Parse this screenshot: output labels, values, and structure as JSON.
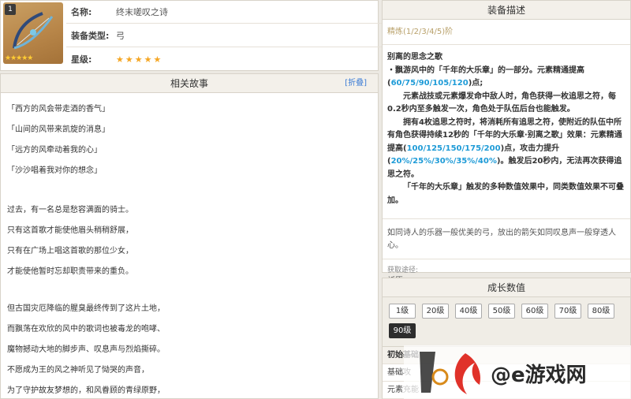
{
  "item": {
    "level_badge": "1",
    "rarity_stars": "★★★★★",
    "name_key": "名称:",
    "name_val": "终末嗟叹之诗",
    "type_key": "装备类型:",
    "type_val": "弓",
    "star_key": "星级:",
    "star_val": "★★★★★"
  },
  "story": {
    "title": "相关故事",
    "collapse": "[折叠]",
    "lines_a": [
      "「西方的风会带走酒的香气」",
      "「山间的风带来凯旋的消息」",
      "「远方的风牵动着我的心」",
      "「沙沙唱着我对你的想念」"
    ],
    "lines_b": [
      "过去，有一名总是愁容满面的骑士。",
      "只有这首歌才能使他眉头稍稍舒展，",
      "只有在广场上唱这首歌的那位少女，",
      "才能使他暂时忘却职责带来的重负。"
    ],
    "lines_c": [
      "但古国灾厄降临的腥臭最终传到了这片土地，",
      "而飘荡在欢欣的风中的歌词也被毒龙的咆哮、",
      "魔物撼动大地的脚步声、叹息声与烈焰撕碎。",
      "不愿成为王的风之神听见了恸哭的声音，",
      "为了守护故友梦想的，和风眷顾的青绿原野，"
    ]
  },
  "desc": {
    "title": "装备描述",
    "refine": "精炼(1/2/3/4/5)阶",
    "skill_name": "别离的思念之歌",
    "p1_a": "・飘游风中的「千年的大乐章」的一部分。元素精通提高",
    "p1_b": "60/75/90/105/120",
    "p1_c": ")点;",
    "p1_open": "(",
    "p2": "元素战技或元素爆发命中敌人时，角色获得一枚追思之符，每0.2秒内至多触发一次，角色处于队伍后台也能触发。",
    "p3_a": "拥有4枚追思之符时，将消耗所有追思之符，使附近的队伍中所有角色获得持续12秒的「千年的大乐章·别离之歌」效果：元素精通提高(",
    "p3_b": "100/125/150/175/200",
    "p3_c": ")点，攻击力提升(",
    "p3_d": "20%/25%/30%/35%/40%",
    "p3_e": ")。触发后20秒内，无法再次获得追思之符。",
    "p4": "「千年的大乐章」触发的多种数值效果中，同类数值效果不可叠加。",
    "flavor": "如同诗人的乐器一般优美的弓，放出的箭矢如同叹息声一般穿透人心。",
    "source_key": "获取途径:",
    "source_val": "祈愿"
  },
  "growth": {
    "title": "成长数值",
    "levels": [
      "1级",
      "20级",
      "40级",
      "50级",
      "60级",
      "70级",
      "80级",
      "90级"
    ],
    "active_level": "90级",
    "table_head": "初始基础",
    "row1": "基础攻",
    "row2": "元素充能"
  },
  "watermark": {
    "text": "@e游戏网"
  }
}
